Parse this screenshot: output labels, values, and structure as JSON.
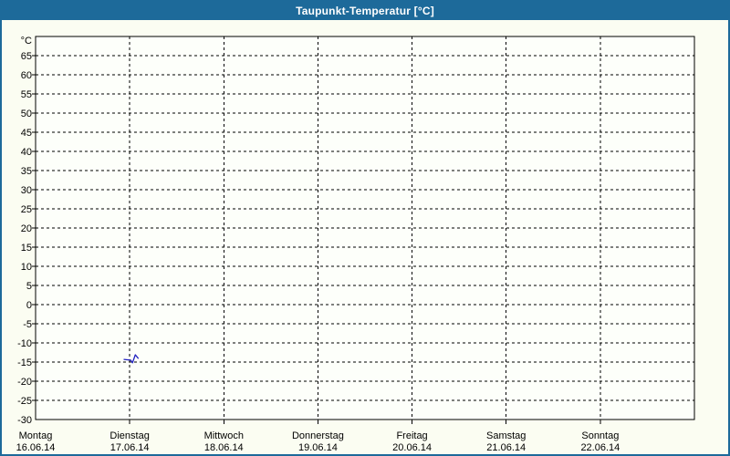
{
  "window": {
    "title": "Taupunkt-Temperatur [°C]",
    "colors": {
      "title_bar": "#1d6a9a",
      "border": "#1d6a9a",
      "background": "#fbfdf2",
      "plot_background": "#fdfffa",
      "grid": "#000000",
      "text": "#000000"
    }
  },
  "chart_data": {
    "type": "line",
    "title": "Taupunkt-Temperatur [°C]",
    "ylabel": "°C",
    "ylim": [
      -30,
      70
    ],
    "ytick_step": 5,
    "yticks": [
      65,
      60,
      55,
      50,
      45,
      40,
      35,
      30,
      25,
      20,
      15,
      10,
      5,
      0,
      -5,
      -10,
      -15,
      -20,
      -25,
      -30
    ],
    "grid": "dashed",
    "legend": "none",
    "x_days": [
      {
        "weekday": "Montag",
        "date": "16.06.14"
      },
      {
        "weekday": "Dienstag",
        "date": "17.06.14"
      },
      {
        "weekday": "Mittwoch",
        "date": "18.06.14"
      },
      {
        "weekday": "Donnerstag",
        "date": "19.06.14"
      },
      {
        "weekday": "Freitag",
        "date": "20.06.14"
      },
      {
        "weekday": "Samstag",
        "date": "21.06.14"
      },
      {
        "weekday": "Sonntag",
        "date": "22.06.14"
      }
    ],
    "x_unit": "days_since_monday_midnight",
    "series": [
      {
        "name": "Taupunkt",
        "color": "#2020c0",
        "points": [
          [
            0.94,
            -14.3
          ],
          [
            1.01,
            -14.5
          ],
          [
            1.03,
            -15.2
          ],
          [
            1.06,
            -13.1
          ],
          [
            1.09,
            -14.0
          ]
        ]
      }
    ]
  }
}
